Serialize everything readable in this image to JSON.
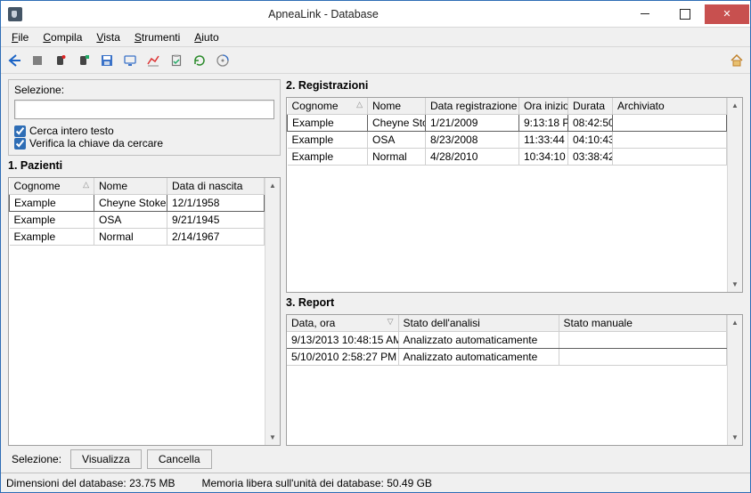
{
  "window": {
    "title": "ApneaLink - Database"
  },
  "menu": {
    "file": "File",
    "compila": "Compila",
    "vista": "Vista",
    "strumenti": "Strumenti",
    "aiuto": "Aiuto"
  },
  "left": {
    "selezione_label": "Selezione:",
    "search_value": "",
    "chk_intero": "Cerca intero testo",
    "chk_chiave": "Verifica la chiave da cercare",
    "section": "1. Pazienti",
    "col_cognome": "Cognome",
    "col_nome": "Nome",
    "col_nascita": "Data di nascita",
    "rows": [
      {
        "cognome": "Example",
        "nome": "Cheyne Stokes",
        "nascita": "12/1/1958"
      },
      {
        "cognome": "Example",
        "nome": "OSA",
        "nascita": "9/21/1945"
      },
      {
        "cognome": "Example",
        "nome": "Normal",
        "nascita": "2/14/1967"
      }
    ]
  },
  "reg": {
    "section": "2. Registrazioni",
    "col_cognome": "Cognome",
    "col_nome": "Nome",
    "col_data": "Data registrazione",
    "col_ora": "Ora inizio",
    "col_durata": "Durata",
    "col_arch": "Archiviato",
    "rows": [
      {
        "cognome": "Example",
        "nome": "Cheyne Sto",
        "data": "1/21/2009",
        "ora": "9:13:18 P",
        "durata": "08:42:50",
        "arch": ""
      },
      {
        "cognome": "Example",
        "nome": "OSA",
        "data": "8/23/2008",
        "ora": "11:33:44",
        "durata": "04:10:43",
        "arch": ""
      },
      {
        "cognome": "Example",
        "nome": "Normal",
        "data": "4/28/2010",
        "ora": "10:34:10",
        "durata": "03:38:42",
        "arch": ""
      }
    ]
  },
  "rep": {
    "section": "3. Report",
    "col_data": "Data, ora",
    "col_stato": "Stato dell'analisi",
    "col_manuale": "Stato manuale",
    "rows": [
      {
        "data": "9/13/2013 10:48:15 AM",
        "stato": "Analizzato automaticamente",
        "manuale": ""
      },
      {
        "data": "5/10/2010 2:58:27 PM",
        "stato": "Analizzato automaticamente",
        "manuale": ""
      }
    ]
  },
  "cmd": {
    "label": "Selezione:",
    "visualizza": "Visualizza",
    "cancella": "Cancella"
  },
  "status": {
    "dim_lbl": "Dimensioni del database:",
    "dim_val": "23.75 MB",
    "free_lbl": "Memoria libera sull'unità dei database:",
    "free_val": "50.49 GB"
  }
}
